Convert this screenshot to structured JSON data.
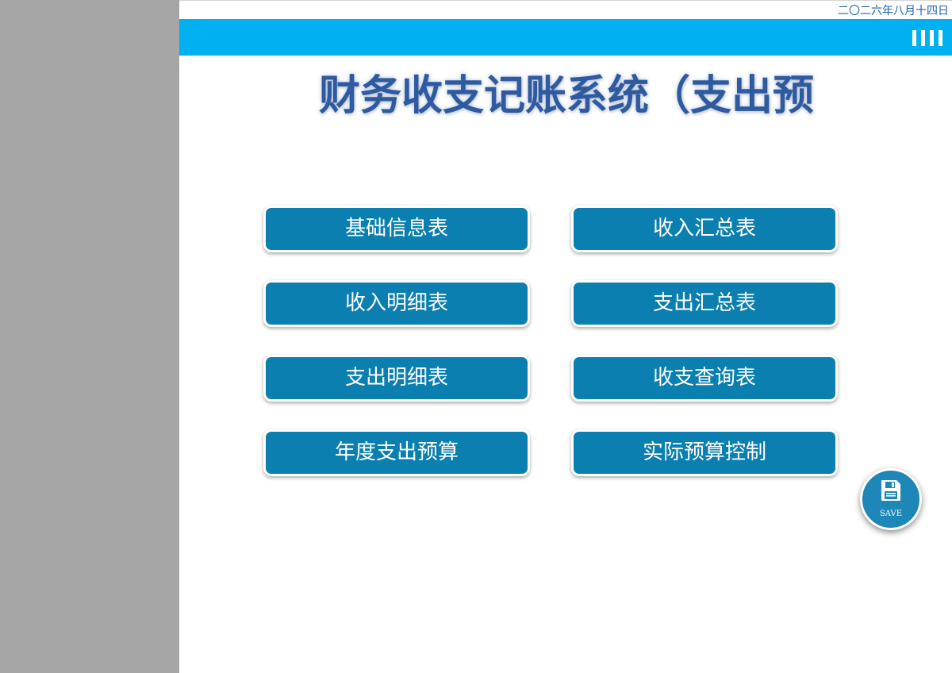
{
  "header": {
    "date": "二〇二六年八月十四日"
  },
  "title": "财务收支记账系统（支出预",
  "buttons": [
    {
      "label": "基础信息表"
    },
    {
      "label": "收入汇总表"
    },
    {
      "label": "收入明细表"
    },
    {
      "label": "支出汇总表"
    },
    {
      "label": "支出明细表"
    },
    {
      "label": "收支查询表"
    },
    {
      "label": "年度支出预算"
    },
    {
      "label": "实际预算控制"
    }
  ],
  "save_button": {
    "label": "SAVE",
    "icon": "floppy-disk-icon"
  },
  "menu_icon": "menu-bars-icon",
  "colors": {
    "header_bar": "#00b0f0",
    "button": "#0a7fb0",
    "title": "#2e5aa0",
    "left_panel": "#a6a6a6",
    "date_text": "#1f63a8"
  }
}
